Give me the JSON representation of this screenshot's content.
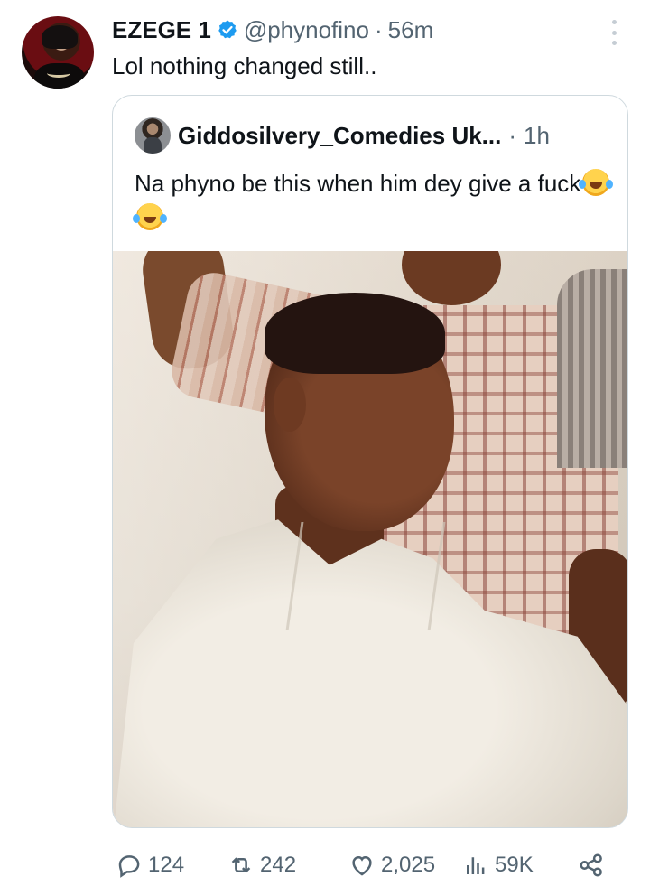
{
  "tweet": {
    "author": {
      "display_name": "EZEGE 1",
      "handle": "@phynofino",
      "separator": "·",
      "time": "56m",
      "verified": true,
      "verified_color": "#1d9bf0"
    },
    "text": "Lol nothing changed still..",
    "quote": {
      "author_name": "Giddosilvery_Comedies Uk...",
      "separator": "·",
      "time": "1h",
      "text": "Na phyno be this when him dey give a fuck",
      "emojis": [
        "rolling-on-floor-laughing-emoji",
        "rolling-on-floor-laughing-emoji"
      ]
    },
    "actions": {
      "replies": "124",
      "reposts": "242",
      "likes": "2,025",
      "views": "59K"
    }
  },
  "colors": {
    "text_primary": "#0f1419",
    "text_secondary": "#536471",
    "border": "#cfd9de"
  }
}
